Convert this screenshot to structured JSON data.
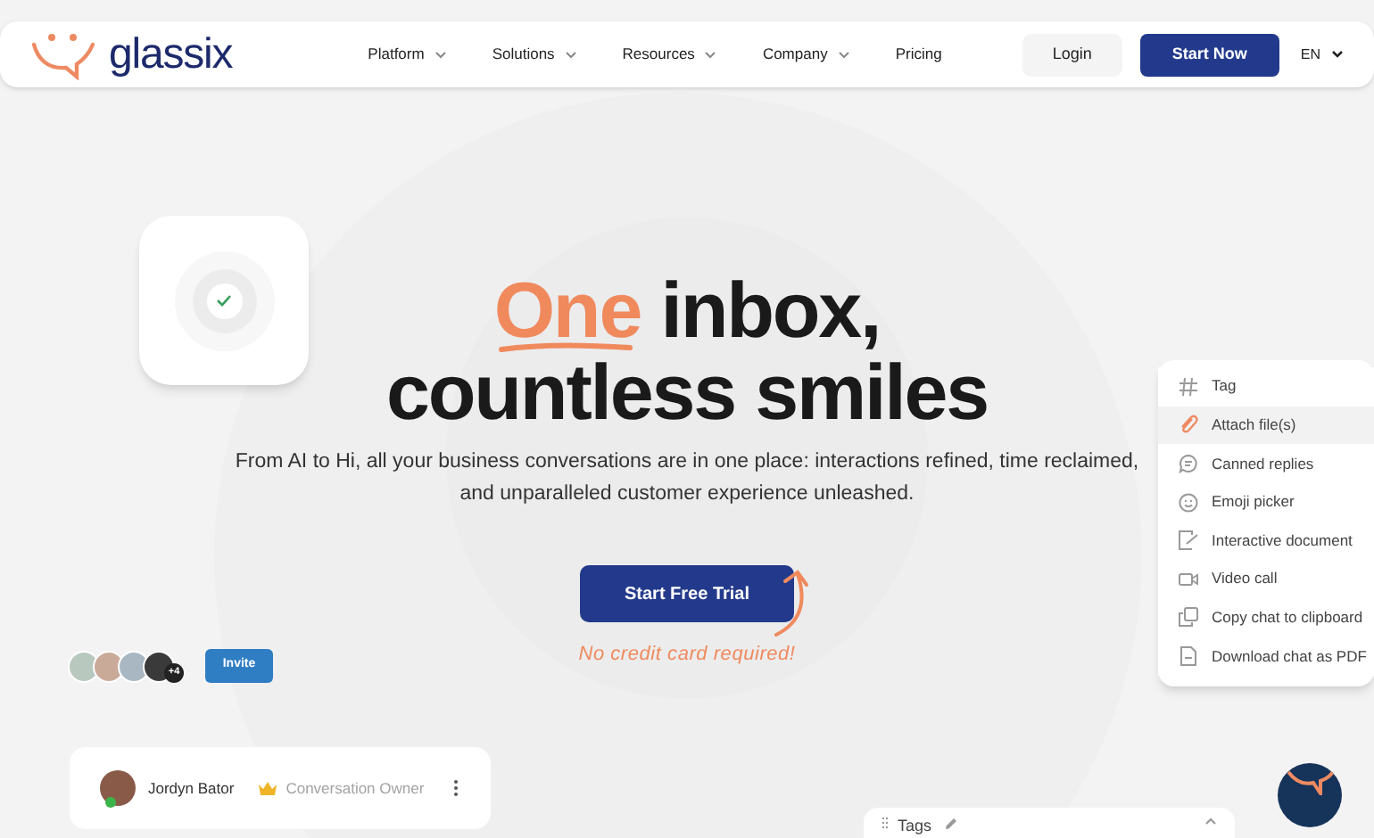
{
  "brand": {
    "name": "glassix"
  },
  "nav": [
    {
      "label": "Platform",
      "dropdown": true
    },
    {
      "label": "Solutions",
      "dropdown": true
    },
    {
      "label": "Resources",
      "dropdown": true
    },
    {
      "label": "Company",
      "dropdown": true
    },
    {
      "label": "Pricing",
      "dropdown": false
    }
  ],
  "login": "Login",
  "start_now": "Start Now",
  "language": "EN",
  "headline": {
    "accent": "One",
    "line_1_rest": "inbox,",
    "line_2": "countless smiles"
  },
  "subtitle": "From AI to Hi, all your business conversations are in one place: interactions refined, time reclaimed, and unparalleled customer experience unleashed.",
  "cta": "Start Free Trial",
  "note": "No credit card required!",
  "team": {
    "extra_count": "+4",
    "invite": "Invite"
  },
  "owner_card": {
    "name": "Jordyn Bator",
    "online": true,
    "role": "Conversation Owner"
  },
  "actions_menu": [
    {
      "kind": "tag",
      "label": "Tag",
      "selected": false
    },
    {
      "kind": "attach",
      "label": "Attach file(s)",
      "selected": true
    },
    {
      "kind": "canned",
      "label": "Canned replies",
      "selected": false
    },
    {
      "kind": "emoji",
      "label": "Emoji picker",
      "selected": false
    },
    {
      "kind": "document",
      "label": "Interactive document",
      "selected": false
    },
    {
      "kind": "video",
      "label": "Video call",
      "selected": false
    },
    {
      "kind": "copy",
      "label": "Copy chat to clipboard",
      "selected": false
    },
    {
      "kind": "pdf",
      "label": "Download chat as PDF",
      "selected": false
    }
  ],
  "tags_panel": {
    "title": "Tags",
    "expanded": true
  }
}
